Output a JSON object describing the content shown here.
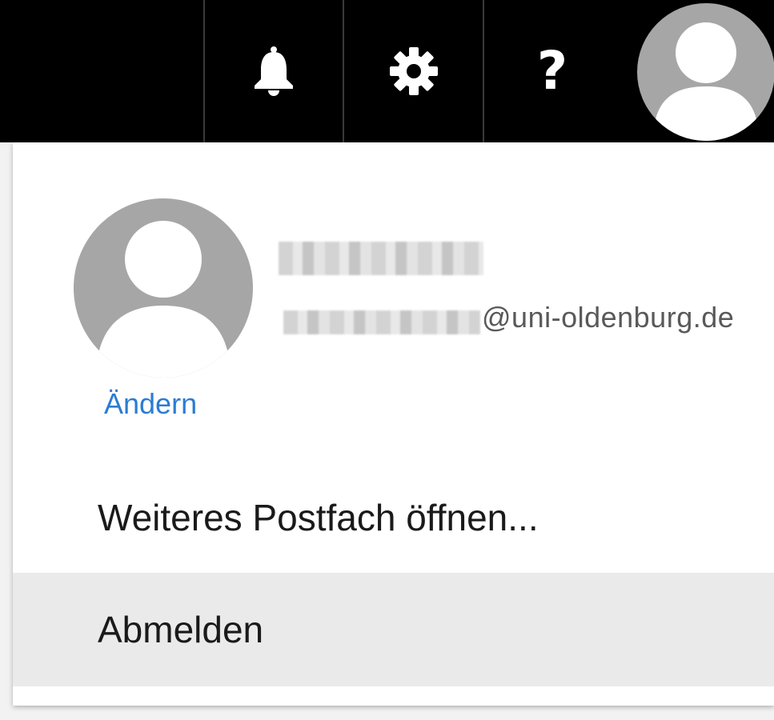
{
  "topbar": {
    "icons": {
      "notifications": "bell-icon",
      "settings": "gear-icon",
      "help": "help-icon",
      "account": "avatar-icon"
    },
    "help_glyph": "?",
    "background": "#000000"
  },
  "account_panel": {
    "email_domain": "@uni-oldenburg.de",
    "change_label": "Ändern",
    "menu": {
      "open_other_mailbox": "Weiteres Postfach öffnen...",
      "sign_out": "Abmelden"
    }
  },
  "colors": {
    "link": "#2b7cd3",
    "avatar_gray": "#a6a6a6",
    "hover_row": "#eaeaea"
  }
}
